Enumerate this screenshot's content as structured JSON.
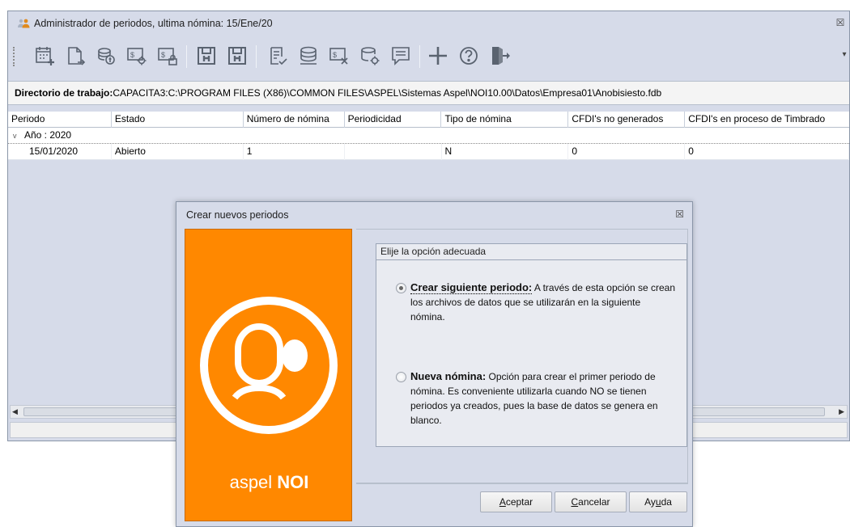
{
  "window": {
    "title": "Administrador de periodos, ultima nómina: 15/Ene/20",
    "close_glyph": "☒"
  },
  "toolbar": {
    "icons": [
      "calendar-add-icon",
      "new-document-icon",
      "coins-icon",
      "payroll-settings-icon",
      "payroll-lock-icon",
      "save-icon",
      "save-as-icon",
      "document-check-icon",
      "database-stack-icon",
      "payroll-cancel-icon",
      "database-settings-icon",
      "notes-icon",
      "add-icon",
      "help-icon",
      "exit-icon"
    ],
    "overflow_glyph": "▾"
  },
  "workdir": {
    "label": "Directorio de trabajo:",
    "path": "CAPACITA3:C:\\PROGRAM FILES (X86)\\COMMON FILES\\ASPEL\\Sistemas Aspel\\NOI10.00\\Datos\\Empresa01\\Anobisiesto.fdb"
  },
  "grid": {
    "columns": [
      "Periodo",
      "Estado",
      "Número de nómina",
      "Periodicidad",
      "Tipo de nómina",
      "CFDI's no generados",
      "CFDI's en proceso de Timbrado"
    ],
    "group_label": "Año : 2020",
    "group_chevron": "v",
    "rows": [
      [
        "15/01/2020",
        "Abierto",
        "1",
        "",
        "N",
        "0",
        "0"
      ]
    ]
  },
  "dialog": {
    "title": "Crear nuevos periodos",
    "close_glyph": "☒",
    "brand_light": "aspel ",
    "brand_bold": "NOI",
    "group_title": "Elije la opción adecuada",
    "option1": {
      "head": "Crear siguiente periodo:",
      "body": " A través de esta opción se crean los archivos de datos que se utilizarán en la siguiente nómina.",
      "checked": true
    },
    "option2": {
      "head": "Nueva nómina:",
      "body": " Opción para crear el primer periodo de nómina. Es conveniente utilizarla cuando NO se tienen periodos ya creados, pues la base de datos se genera en blanco.",
      "checked": false
    },
    "buttons": {
      "accept_hot": "A",
      "accept_rest": "ceptar",
      "cancel_hot": "C",
      "cancel_rest": "ancelar",
      "help_pre": "Ay",
      "help_hot": "u",
      "help_post": "da"
    }
  },
  "colors": {
    "brand_orange": "#ff8800",
    "window_bg": "#d6dbe9"
  }
}
